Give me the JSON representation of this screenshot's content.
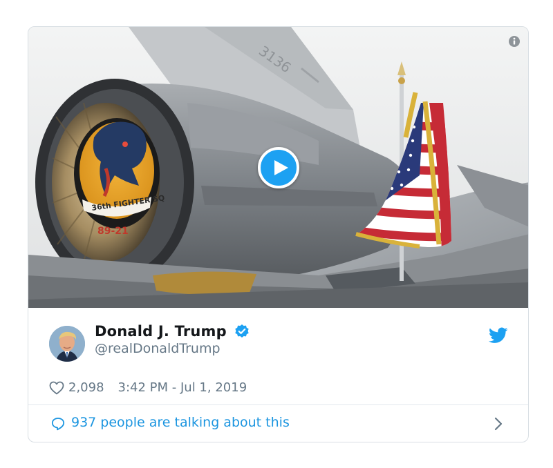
{
  "tweet": {
    "display_name": "Donald J. Trump",
    "handle": "@realDonaldTrump",
    "like_count": "2,098",
    "timestamp": "3:42 PM - Jul 1, 2019",
    "talking": "937 people are talking about this",
    "verified": true
  },
  "media": {
    "type": "video",
    "subject": "fighter jet tail with American flag",
    "jet_tail_number": "3136",
    "patch_text": "36th FIGHTER SQ",
    "patch_number": "89-21",
    "icons": [
      "info-icon",
      "play-icon"
    ]
  },
  "icons": {
    "verified": "verified-badge-icon",
    "brand": "twitter-bird-icon",
    "like": "heart-icon",
    "talk": "speech-bubble-icon",
    "chevron": "chevron-right-icon"
  },
  "colors": {
    "accent": "#1da1f2",
    "link": "#1b95e0",
    "name": "#14171a",
    "secondary": "#657786",
    "border": "#e1e8ed"
  }
}
